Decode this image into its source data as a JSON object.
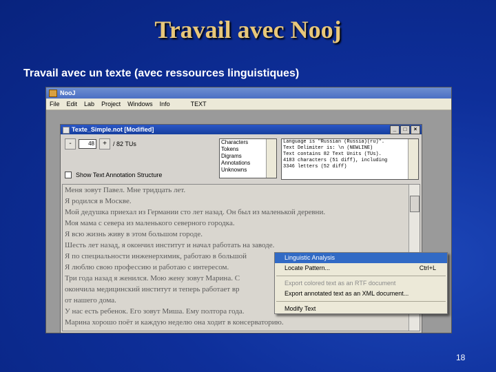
{
  "slide": {
    "title": "Travail avec Nooj",
    "subtitle": "Travail avec un texte (avec ressources linguistiques)",
    "page_number": "18"
  },
  "app": {
    "title": "NooJ",
    "menu": [
      "File",
      "Edit",
      "Lab",
      "Project",
      "Windows",
      "Info",
      "TEXT"
    ]
  },
  "doc": {
    "title": "Texte_Simple.not [Modified]",
    "minus": "-",
    "plus": "+",
    "tu_value": "48",
    "tu_total": "/ 82 TUs",
    "list_items": [
      "Characters",
      "Tokens",
      "Digrams",
      "Annotations",
      "Unknowns"
    ],
    "info_lines": [
      "Language is \"Russian (Russia)(ru)\".",
      "Text Delimiter is: \\n (NEWLINE)",
      "Text contains 82 Text Units (TUs).",
      "4183 characters (51 diff), including",
      "  3346 letters  (52 diff)"
    ],
    "checkbox_label": "Show Text Annotation Structure",
    "text_lines": [
      "Меня зовут Павел. Мне тридцать лет.",
      "Я родился в Москве.",
      "Мой дедушка приехал из Германии сто лет назад. Он был из маленькой деревни.",
      "Моя мама с севера из маленького северного городка.",
      "Я всю жизнь живу в этом большом городе.",
      "Шесть лет назад, я окончил институт  и начал работать на заводе.",
      "Я по специальности инженерхимик, работаю в большой",
      "Я люблю свою профессию и работаю с интересом.",
      "Три года назад я женился. Мою жену зовут Марина. С",
      "окончила медицинский институт и теперь работает вр",
      "от нашего дома.",
      "У нас есть ребенок. Его зовут Миша. Ему полтора года.",
      "Марина хорошо поёт и каждую неделю она ходит в консерваторию."
    ]
  },
  "context_menu": {
    "linguistic_analysis": "Linguistic Analysis",
    "locate_pattern": "Locate Pattern...",
    "locate_shortcut": "Ctrl+L",
    "export_rtf": "Export colored text as an RTF document",
    "export_xml": "Export annotated text as an XML document...",
    "modify_text": "Modify Text"
  }
}
